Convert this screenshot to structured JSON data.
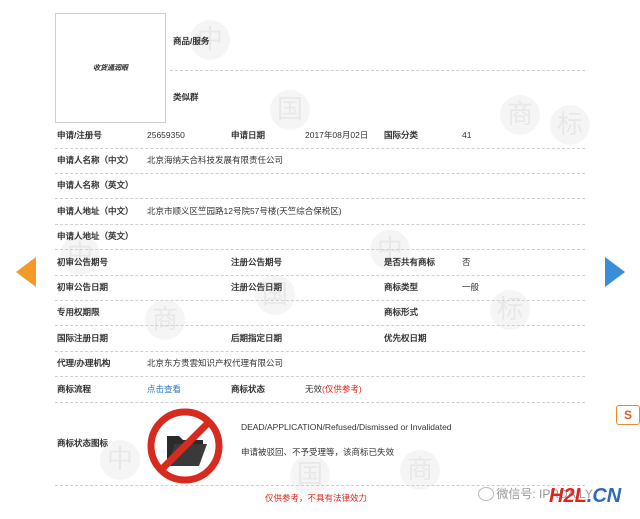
{
  "logo_text": "收货通润眼",
  "header": {
    "goods_label": "商品/服务",
    "similar_label": "类似群"
  },
  "rows": {
    "reg_no_label": "申请/注册号",
    "reg_no": "25659350",
    "apply_date_label": "申请日期",
    "apply_date": "2017年08月02日",
    "intl_class_label": "国际分类",
    "intl_class": "41",
    "applicant_cn_label": "申请人名称（中文）",
    "applicant_cn": "北京海纳天合科技发展有限责任公司",
    "applicant_en_label": "申请人名称（英文）",
    "address_cn_label": "申请人地址（中文）",
    "address_cn": "北京市顺义区竺园路12号院57号楼(天竺综合保税区)",
    "address_en_label": "申请人地址（英文）",
    "prelim_no_label": "初审公告期号",
    "reg_pub_no_label": "注册公告期号",
    "shared_label": "是否共有商标",
    "shared": "否",
    "prelim_date_label": "初审公告日期",
    "reg_pub_date_label": "注册公告日期",
    "tm_type_label": "商标类型",
    "tm_type": "一般",
    "exclusive_label": "专用权期限",
    "tm_form_label": "商标形式",
    "intl_reg_date_label": "国际注册日期",
    "later_date_label": "后期指定日期",
    "priority_date_label": "优先权日期",
    "agent_label": "代理/办理机构",
    "agent": "北京东方贵雲知识产权代理有限公司",
    "flow_label": "商标流程",
    "flow_link": "点击查看",
    "status_label": "商标状态",
    "status_value": "无效",
    "status_note": "(仅供参考)",
    "status_icon_label": "商标状态图标",
    "status_en": "DEAD/APPLICATION/Refused/Dismissed or Invalidated",
    "status_cn": "申请被驳回、不予受理等，该商标已失效"
  },
  "footer_note": "仅供参考，不具有法律效力",
  "watermark": {
    "wechat": "微信号: IPRDAILY",
    "brand_left": "H2L",
    "brand_right": ".CN"
  },
  "badge_s": "S",
  "colors": {
    "prev_arrow": "#f29a27",
    "next_arrow": "#3a8ed6",
    "status_red": "#e0241b",
    "link_blue": "#2a76c6"
  }
}
